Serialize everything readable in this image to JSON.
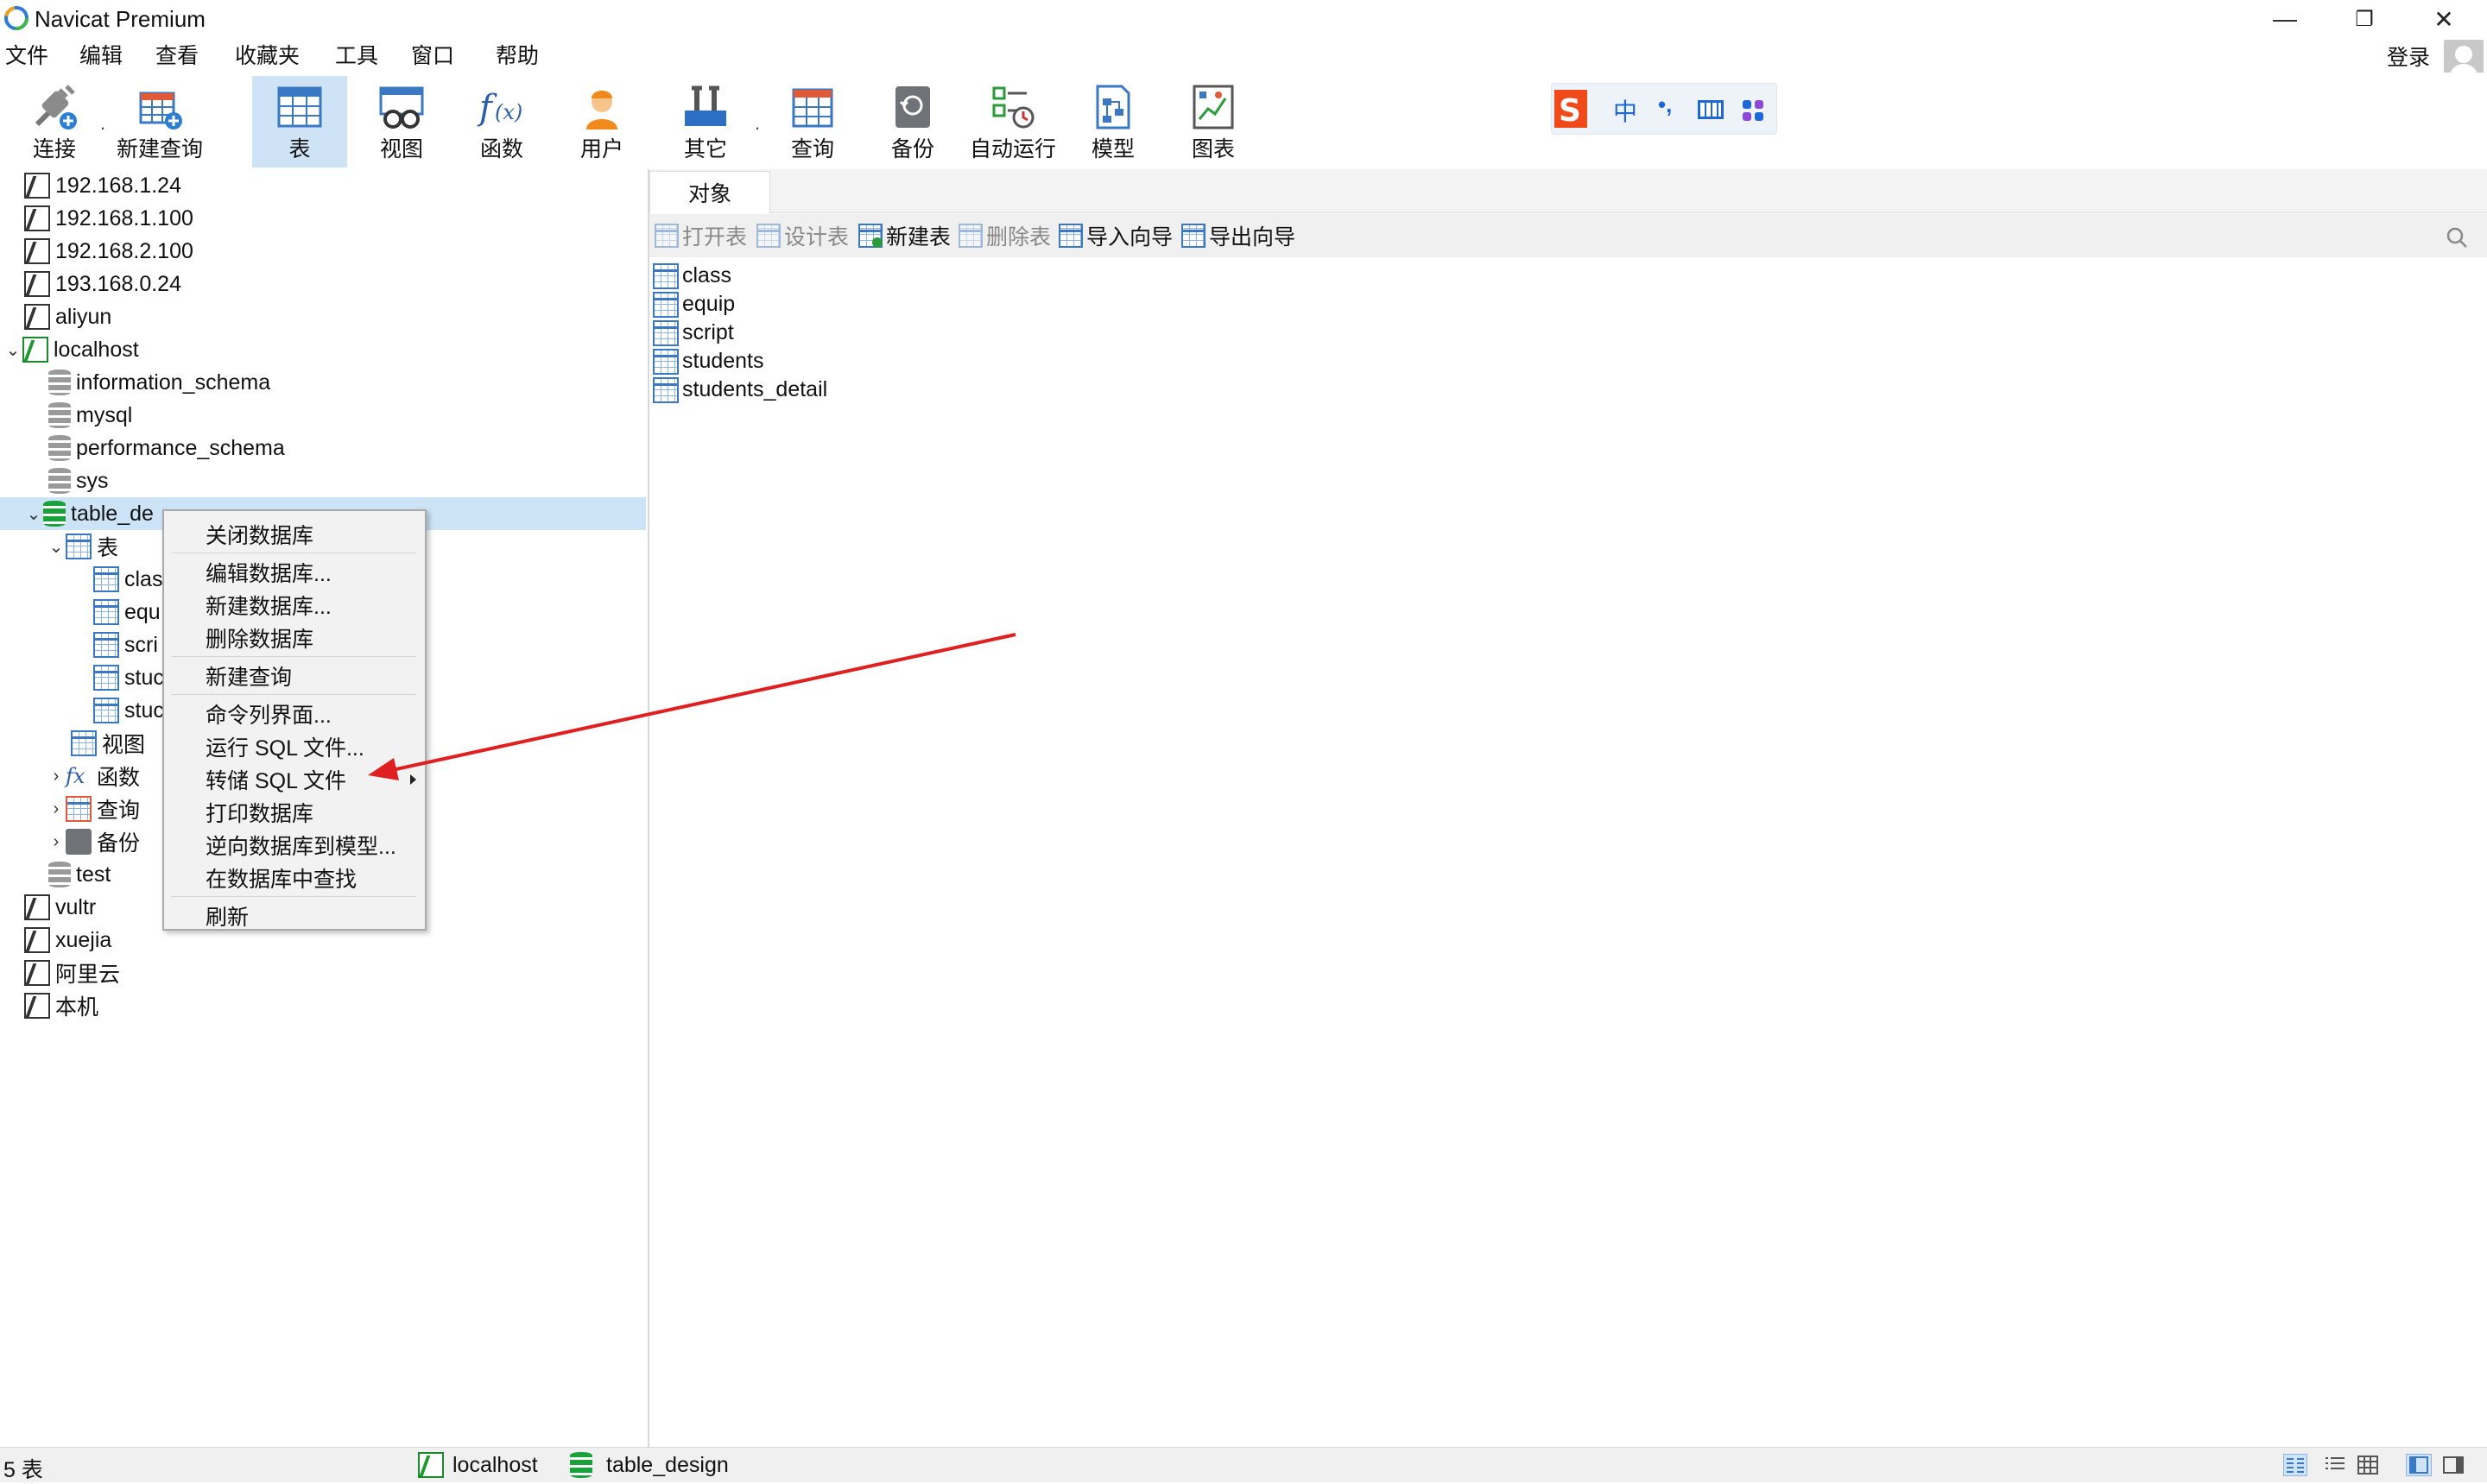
{
  "window": {
    "title": "Navicat Premium",
    "controls": [
      "—",
      "❐",
      "✕"
    ]
  },
  "menubar": {
    "items": [
      "文件",
      "编辑",
      "查看",
      "收藏夹",
      "工具",
      "窗口",
      "帮助"
    ],
    "login": "登录"
  },
  "toolbar": {
    "items": [
      {
        "label": "连接",
        "icon": "plug-icon"
      },
      {
        "label": "新建查询",
        "icon": "new-query-icon"
      },
      {
        "label": "表",
        "icon": "table-icon",
        "active": true
      },
      {
        "label": "视图",
        "icon": "view-icon"
      },
      {
        "label": "函数",
        "icon": "function-icon"
      },
      {
        "label": "用户",
        "icon": "user-icon"
      },
      {
        "label": "其它",
        "icon": "tools-icon"
      },
      {
        "label": "查询",
        "icon": "query-icon"
      },
      {
        "label": "备份",
        "icon": "backup-icon"
      },
      {
        "label": "自动运行",
        "icon": "auto-run-icon"
      },
      {
        "label": "模型",
        "icon": "model-icon"
      },
      {
        "label": "图表",
        "icon": "chart-icon"
      }
    ],
    "ime": {
      "label": "中",
      "punct": "•,"
    }
  },
  "tree": {
    "connections_top": [
      "192.168.1.24",
      "192.168.1.100",
      "192.168.2.100",
      "193.168.0.24",
      "aliyun"
    ],
    "localhost": {
      "label": "localhost",
      "databases": [
        "information_schema",
        "mysql",
        "performance_schema",
        "sys"
      ],
      "selected_db": "table_design",
      "selected_db_visible": "table_de",
      "tables_group": "表",
      "tables_truncated": [
        "clas",
        "equ",
        "scri",
        "stuc",
        "stuc"
      ],
      "views": "视图",
      "functions": "函数",
      "queries": "查询",
      "backups": "备份",
      "test_db": "test"
    },
    "connections_bottom": [
      "vultr",
      "xuejia",
      "阿里云",
      "本机"
    ]
  },
  "context_menu": {
    "items": [
      "关闭数据库",
      "编辑数据库...",
      "新建数据库...",
      "删除数据库",
      "新建查询",
      "命令列界面...",
      "运行 SQL 文件...",
      "转储 SQL 文件",
      "打印数据库",
      "逆向数据库到模型...",
      "在数据库中查找",
      "刷新"
    ]
  },
  "right_pane": {
    "tab": "对象",
    "actions": [
      {
        "label": "打开表",
        "disabled": true
      },
      {
        "label": "设计表",
        "disabled": true
      },
      {
        "label": "新建表",
        "disabled": false
      },
      {
        "label": "删除表",
        "disabled": true
      },
      {
        "label": "导入向导",
        "disabled": false
      },
      {
        "label": "导出向导",
        "disabled": false
      }
    ],
    "tables": [
      "class",
      "equip",
      "script",
      "students",
      "students_detail"
    ]
  },
  "statusbar": {
    "count": "5 表",
    "connection": "localhost",
    "database": "table_design"
  },
  "colors": {
    "accent": "#cfe3f6",
    "arrow": "#e02020",
    "connected": "#1a9a2a",
    "table_blue": "#3b78c4"
  }
}
